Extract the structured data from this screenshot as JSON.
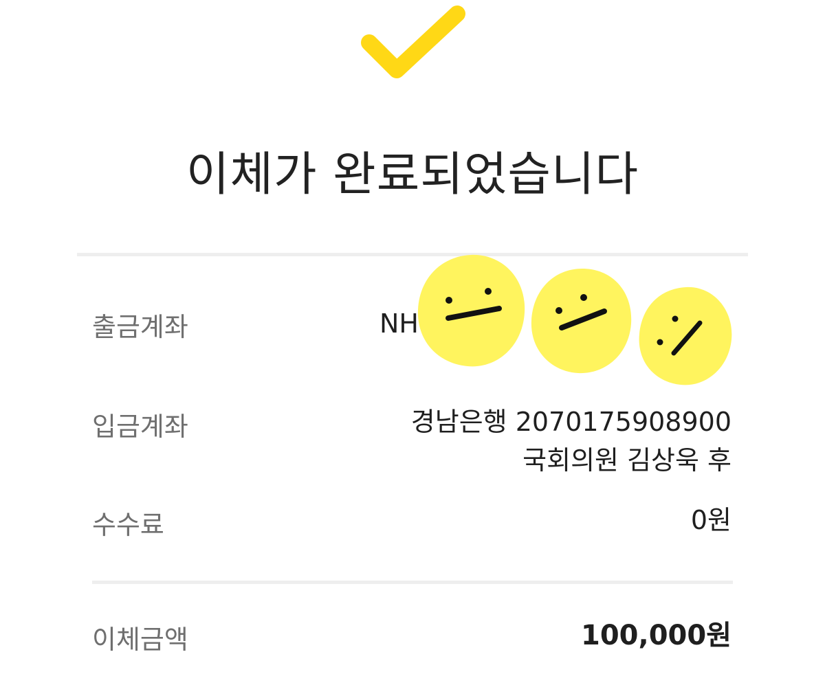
{
  "header": {
    "icon": "check-icon",
    "title": "이체가 완료되었습니다"
  },
  "rows": {
    "withdraw": {
      "label": "출금계좌",
      "value_line1": "NH"
    },
    "deposit": {
      "label": "입금계좌",
      "value_line1": "경남은행 2070175908900",
      "value_line2": "국회의원 김상욱 후"
    },
    "fee": {
      "label": "수수료",
      "value": "0원"
    },
    "amount": {
      "label": "이체금액",
      "value": "100,000원"
    }
  },
  "colors": {
    "accent": "#ffd816",
    "sticker": "#fff45e",
    "divider": "#eeeeee",
    "label": "#6f6f6f",
    "text": "#1f1f1f"
  }
}
